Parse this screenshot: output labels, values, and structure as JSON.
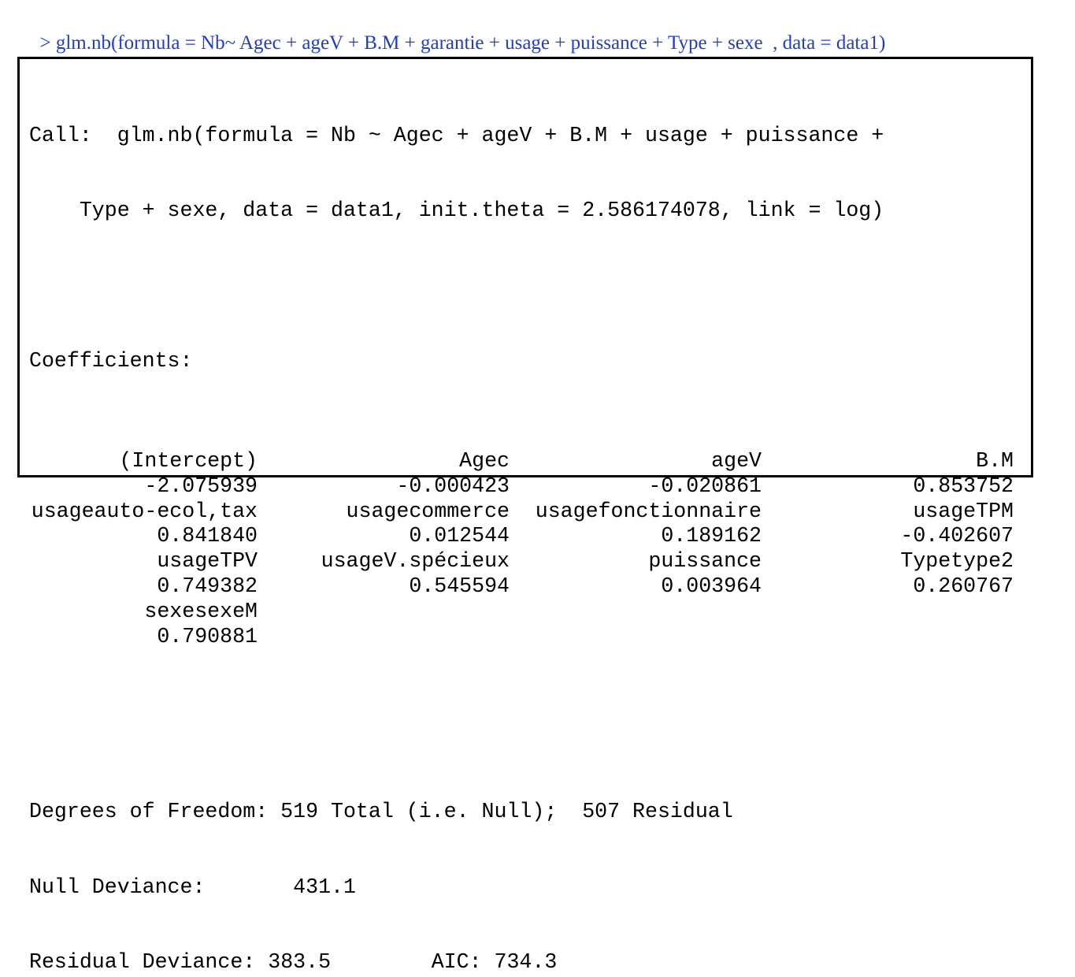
{
  "command": {
    "text": "> glm.nb(formula = Nb~ Agec + ageV + B.M + garantie + usage + puissance + Type + sexe  , data = data1)"
  },
  "output": {
    "call_line1": "Call:  glm.nb(formula = Nb ~ Agec + ageV + B.M + usage + puissance +",
    "call_line2": "    Type + sexe, data = data1, init.theta = 2.586174078, link = log)",
    "coefficients_header": "Coefficients:",
    "coefficients": [
      {
        "names": [
          "(Intercept)",
          "Agec",
          "ageV",
          "B.M"
        ],
        "values": [
          "-2.075939",
          "-0.000423",
          "-0.020861",
          "0.853752"
        ]
      },
      {
        "names": [
          "usageauto-ecol,tax",
          "usagecommerce",
          "usagefonctionnaire",
          "usageTPM"
        ],
        "values": [
          "0.841840",
          "0.012544",
          "0.189162",
          "-0.402607"
        ]
      },
      {
        "names": [
          "usageTPV",
          "usageV.spécieux",
          "puissance",
          "Typetype2"
        ],
        "values": [
          "0.749382",
          "0.545594",
          "0.003964",
          "0.260767"
        ]
      },
      {
        "names": [
          "sexesexeM",
          "",
          "",
          ""
        ],
        "values": [
          "0.790881",
          "",
          "",
          ""
        ]
      }
    ],
    "dof_line": "Degrees of Freedom: 519 Total (i.e. Null);  507 Residual",
    "null_deviance_label": "Null Deviance:",
    "null_deviance_value": "431.1",
    "residual_deviance_label": "Residual Deviance:",
    "residual_deviance_value": "383.5",
    "aic_label": "AIC:",
    "aic_value": "734.3"
  },
  "colors": {
    "command_text": "#1f3dcc",
    "output_text": "#000000",
    "border": "#000000"
  }
}
